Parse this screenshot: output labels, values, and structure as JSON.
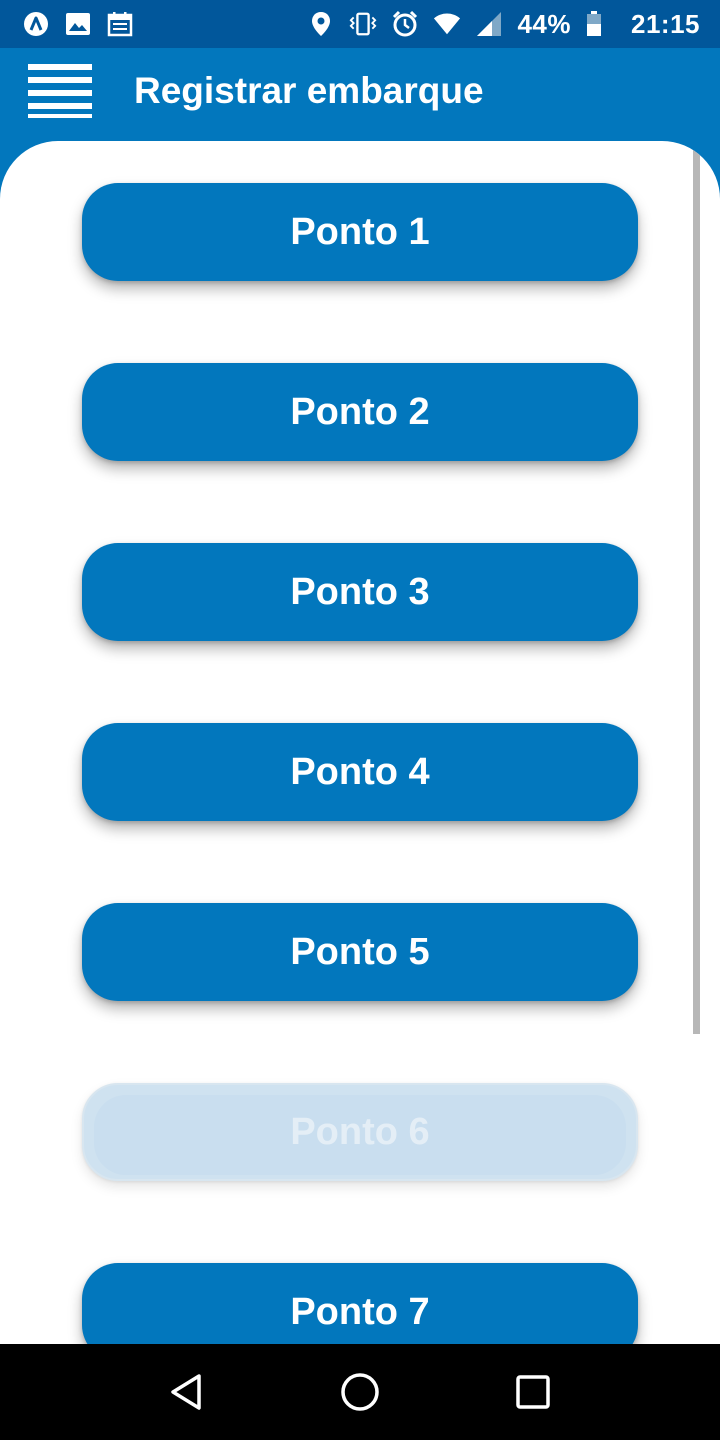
{
  "status_bar": {
    "icons_left": [
      "app-icon",
      "image-icon",
      "calendar-icon"
    ],
    "icons_right": [
      "location-icon",
      "vibrate-icon",
      "alarm-icon",
      "wifi-icon",
      "signal-icon"
    ],
    "battery": "44%",
    "time": "21:15"
  },
  "app_bar": {
    "title": "Registrar embarque",
    "menu_icon": "hamburger-menu-icon"
  },
  "pontos": [
    {
      "label": "Ponto 1",
      "state": "normal"
    },
    {
      "label": "Ponto 2",
      "state": "normal"
    },
    {
      "label": "Ponto 3",
      "state": "normal"
    },
    {
      "label": "Ponto 4",
      "state": "normal"
    },
    {
      "label": "Ponto 5",
      "state": "normal"
    },
    {
      "label": "Ponto 6",
      "state": "pressed"
    },
    {
      "label": "Ponto 7",
      "state": "normal"
    }
  ],
  "nav_bar": {
    "buttons": [
      "back-icon",
      "home-icon",
      "recents-icon"
    ]
  },
  "colors": {
    "primary": "#0277bd",
    "status_bar": "#01579b",
    "surface": "#ffffff",
    "pressed": "#cfe2f0"
  }
}
